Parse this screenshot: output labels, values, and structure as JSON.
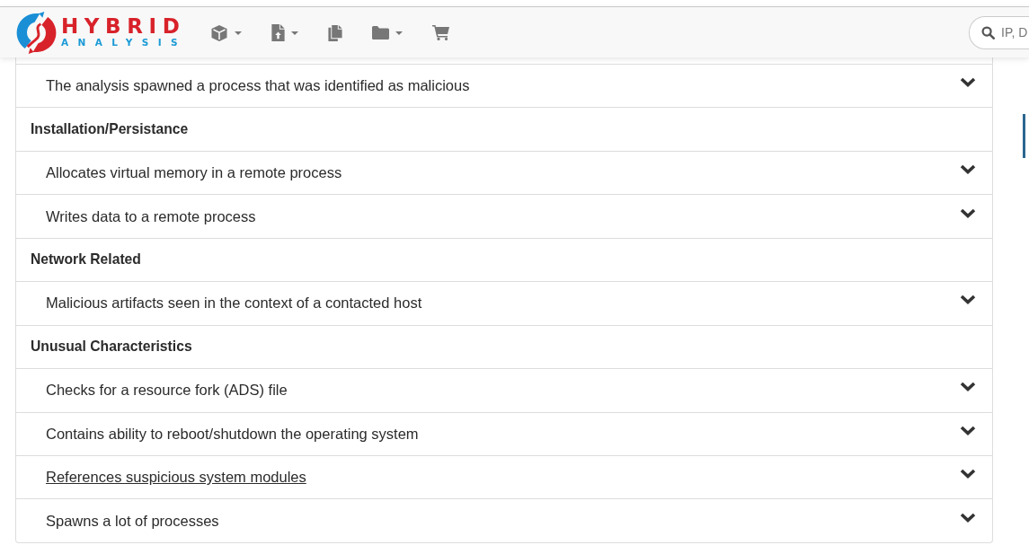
{
  "logo": {
    "title": "HYBRID",
    "subtitle": "ANALYSIS"
  },
  "nav": [
    {
      "kind": "cube",
      "dropdown": true
    },
    {
      "kind": "file-upload",
      "dropdown": true
    },
    {
      "kind": "copy",
      "dropdown": false
    },
    {
      "kind": "folder",
      "dropdown": true
    },
    {
      "kind": "cart",
      "dropdown": false
    }
  ],
  "search": {
    "placeholder": "IP, D"
  },
  "rows": [
    {
      "kind": "signature",
      "text": "The analysis spawned a process that was identified as malicious",
      "expanded": false,
      "hovered": false
    },
    {
      "kind": "category",
      "text": "Installation/Persistance"
    },
    {
      "kind": "signature",
      "text": "Allocates virtual memory in a remote process",
      "expanded": false,
      "hovered": false
    },
    {
      "kind": "signature",
      "text": "Writes data to a remote process",
      "expanded": false,
      "hovered": false
    },
    {
      "kind": "category",
      "text": "Network Related"
    },
    {
      "kind": "signature",
      "text": "Malicious artifacts seen in the context of a contacted host",
      "expanded": false,
      "hovered": false
    },
    {
      "kind": "category",
      "text": "Unusual Characteristics"
    },
    {
      "kind": "signature",
      "text": "Checks for a resource fork (ADS) file",
      "expanded": false,
      "hovered": false
    },
    {
      "kind": "signature",
      "text": "Contains ability to reboot/shutdown the operating system",
      "expanded": false,
      "hovered": false
    },
    {
      "kind": "signature",
      "text": "References suspicious system modules",
      "expanded": false,
      "hovered": true
    },
    {
      "kind": "signature",
      "text": "Spawns a lot of processes",
      "expanded": false,
      "hovered": false
    }
  ]
}
